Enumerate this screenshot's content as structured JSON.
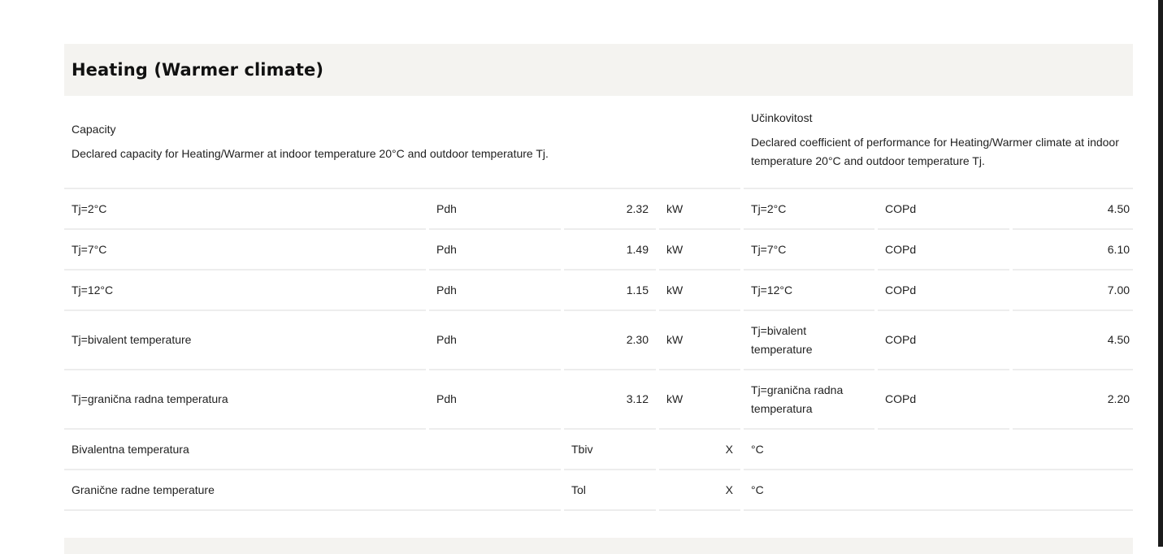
{
  "title": "Heating (Warmer climate)",
  "capacity": {
    "label": "Capacity",
    "description": "Declared capacity for Heating/Warmer at indoor temperature 20°C and outdoor temperature Tj."
  },
  "efficiency": {
    "label": "Učinkovitost",
    "description": "Declared coefficient of performance for Heating/Warmer climate at indoor temperature 20°C and outdoor temperature Tj."
  },
  "rows": [
    {
      "tj": "Tj=2°C",
      "sym": "Pdh",
      "val": "2.32",
      "unit": "kW",
      "tj2": "Tj=2°C",
      "sym2": "COPd",
      "val2": "4.50"
    },
    {
      "tj": "Tj=7°C",
      "sym": "Pdh",
      "val": "1.49",
      "unit": "kW",
      "tj2": "Tj=7°C",
      "sym2": "COPd",
      "val2": "6.10"
    },
    {
      "tj": "Tj=12°C",
      "sym": "Pdh",
      "val": "1.15",
      "unit": "kW",
      "tj2": "Tj=12°C",
      "sym2": "COPd",
      "val2": "7.00"
    },
    {
      "tj": "Tj=bivalent temperature",
      "sym": "Pdh",
      "val": "2.30",
      "unit": "kW",
      "tj2": "Tj=bivalent temperature",
      "sym2": "COPd",
      "val2": "4.50"
    },
    {
      "tj": "Tj=granična radna temperatura",
      "sym": "Pdh",
      "val": "3.12",
      "unit": "kW",
      "tj2": "Tj=granična radna temperatura",
      "sym2": "COPd",
      "val2": "2.20"
    }
  ],
  "extra_rows": [
    {
      "label": "Bivalentna temperatura",
      "sym": "Tbiv",
      "val": "X",
      "unit": "°C"
    },
    {
      "label": "Granične radne temperature",
      "sym": "Tol",
      "val": "X",
      "unit": "°C"
    }
  ]
}
